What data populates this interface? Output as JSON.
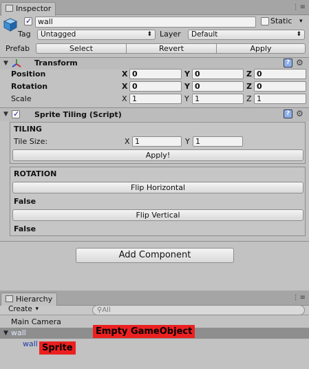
{
  "inspector": {
    "tab_label": "Inspector",
    "object_name": "wall",
    "static_label": "Static",
    "tag_label": "Tag",
    "tag_value": "Untagged",
    "layer_label": "Layer",
    "layer_value": "Default",
    "prefab_label": "Prefab",
    "prefab_buttons": [
      "Select",
      "Revert",
      "Apply"
    ]
  },
  "transform": {
    "title": "Transform",
    "rows": [
      {
        "label": "Position",
        "x": "0",
        "y": "0",
        "z": "0",
        "bold": true
      },
      {
        "label": "Rotation",
        "x": "0",
        "y": "0",
        "z": "0",
        "bold": true
      },
      {
        "label": "Scale",
        "x": "1",
        "y": "1",
        "z": "1",
        "bold": false
      }
    ],
    "axis_labels": [
      "X",
      "Y",
      "Z"
    ]
  },
  "sprite_tiling": {
    "title": "Sprite Tiling (Script)",
    "tiling_header": "TILING",
    "tile_size_label": "Tile Size:",
    "tile_x": "1",
    "tile_y": "1",
    "apply_button": "Apply!",
    "rotation_header": "ROTATION",
    "flip_horizontal_button": "Flip Horizontal",
    "flip_horizontal_value": "False",
    "flip_vertical_button": "Flip Vertical",
    "flip_vertical_value": "False"
  },
  "add_component_button": "Add Component",
  "hierarchy": {
    "tab_label": "Hierarchy",
    "create_button": "Create",
    "search_placeholder": "All",
    "items": [
      "Main Camera",
      "wall",
      "wall"
    ],
    "annotation_empty": "Empty GameObject",
    "annotation_sprite": "Sprite"
  },
  "colors": {
    "panel_bg": "#c2c2c2",
    "selection": "#8e8e8e",
    "annotation_red": "#ec2020"
  }
}
